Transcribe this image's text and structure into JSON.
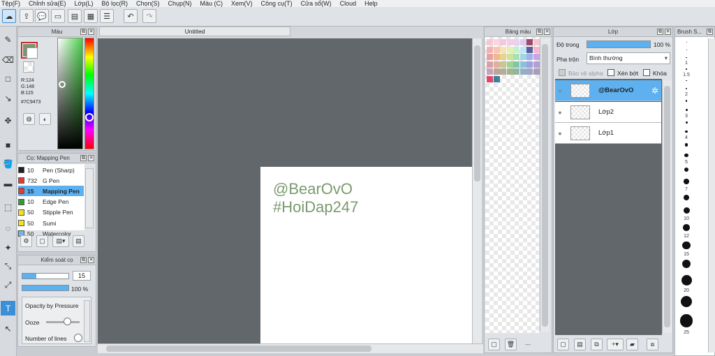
{
  "menu": [
    "Tệp(F)",
    "Chỉnh sửa(E)",
    "Lớp(L)",
    "Bộ lọc(R)",
    "Chọn(S)",
    "Chụp(N)",
    "Màu (C)",
    "Xem(V)",
    "Công cụ(T)",
    "Cửa sổ(W)",
    "Cloud",
    "Help"
  ],
  "canvas": {
    "tab_title": "Untitled",
    "watermark_line1": "@BearOvO",
    "watermark_line2": "#HoiDap247"
  },
  "color_panel": {
    "title": "Màu",
    "r": "R:124",
    "g": "G:148",
    "b": "B:115",
    "hex": "#7C9473",
    "main_color": "#7c9473"
  },
  "brush_panel": {
    "title": "Cọ: Mapping Pen",
    "items": [
      {
        "size": "10",
        "name": "Pen (Sharp)",
        "color": "#222222"
      },
      {
        "size": "732",
        "name": "G Pen",
        "color": "#e53935"
      },
      {
        "size": "15",
        "name": "Mapping Pen",
        "color": "#e53935",
        "selected": true
      },
      {
        "size": "10",
        "name": "Edge Pen",
        "color": "#2e9e2e"
      },
      {
        "size": "50",
        "name": "Stipple Pen",
        "color": "#f2e21c"
      },
      {
        "size": "50",
        "name": "Sumi",
        "color": "#f2e21c"
      },
      {
        "size": "50",
        "name": "Watercolor",
        "color": "#6fb7e8"
      }
    ]
  },
  "brush_control": {
    "title": "Kiểm soát cọ",
    "size_value": "15",
    "opacity_value": "100 %",
    "options": [
      "Opacity by Pressure",
      "Ooze",
      "Number of lines"
    ]
  },
  "palette_panel": {
    "title": "Bảng màu",
    "colors": [
      "#f6c7d4",
      "#f9d6de",
      "#f4c6e0",
      "#f6cde5",
      "#e9d1f0",
      "#dccbf1",
      "#a0486a",
      "#f2c7cf",
      "#f2b2b5",
      "#f4c6b3",
      "#f6e2b6",
      "#e2f0b6",
      "#c5f0d0",
      "#bfe6f3",
      "#5c5f98",
      "#f6b6d0",
      "#eaa0a0",
      "#f0b794",
      "#e8d28c",
      "#cde29b",
      "#a6e0b3",
      "#a3d4e6",
      "#9fb2ea",
      "#c8a6e6",
      "#d9a0a8",
      "#e2b09a",
      "#c9c791",
      "#9ed48f",
      "#7ec7a6",
      "#8ac0df",
      "#9aa2e0",
      "#b79cd6",
      "#c8a3b8",
      "#bca59a",
      "#b5ae95",
      "#a3b58e",
      "#8eb7a2",
      "#91b0c5",
      "#a2a5c6",
      "#a79cbc",
      "#e0466c",
      "#3e7f9a"
    ]
  },
  "layer_panel": {
    "title": "Lớp",
    "opacity_label": "Độ trong",
    "opacity_value": "100 %",
    "blend_label": "Pha trộn",
    "blend_value": "Bình thường",
    "protect_alpha": "Bảo vệ alpha",
    "clipping": "Xén bớt",
    "lock": "Khóa",
    "layers": [
      {
        "name": "@BearOvO",
        "selected": true
      },
      {
        "name": "Lớp2",
        "selected": false
      },
      {
        "name": "Lớp1",
        "selected": false
      }
    ]
  },
  "brush_size_panel": {
    "title": "Brush S...",
    "labels": [
      "1",
      "1.5",
      "2",
      "3",
      "4",
      "5",
      "7",
      "10",
      "12",
      "15",
      "20",
      "25"
    ]
  }
}
